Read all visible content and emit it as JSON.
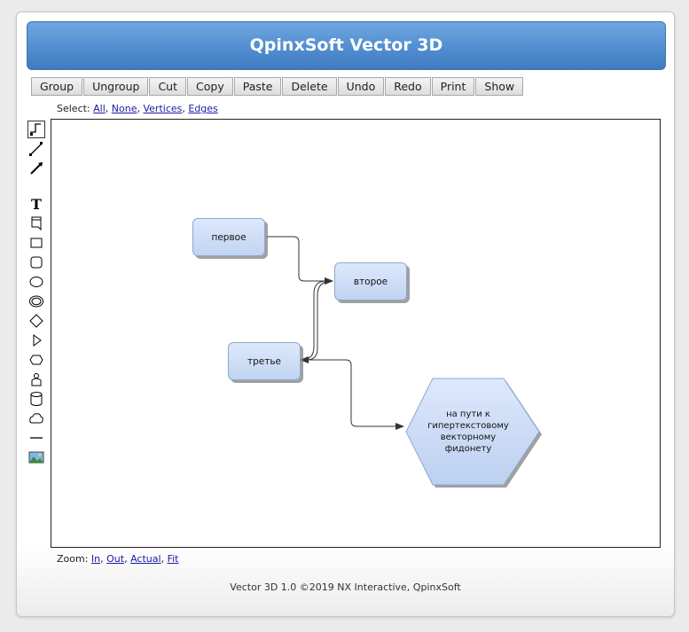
{
  "app": {
    "title": "QpinxSoft Vector 3D"
  },
  "toolbar": {
    "buttons": [
      "Group",
      "Ungroup",
      "Cut",
      "Copy",
      "Paste",
      "Delete",
      "Undo",
      "Redo",
      "Print",
      "Show"
    ]
  },
  "select": {
    "label": "Select:",
    "links": [
      "All",
      "None",
      "Vertices",
      "Edges"
    ]
  },
  "tools": [
    {
      "name": "select-tool-icon",
      "selected": true
    },
    {
      "name": "line-tool-icon"
    },
    {
      "name": "arrow-line-tool-icon"
    },
    {
      "name": "text-tool-icon",
      "glyph": "T"
    },
    {
      "name": "note-shape-tool-icon"
    },
    {
      "name": "rectangle-tool-icon"
    },
    {
      "name": "rounded-rectangle-tool-icon"
    },
    {
      "name": "ellipse-tool-icon"
    },
    {
      "name": "double-ellipse-tool-icon"
    },
    {
      "name": "diamond-tool-icon"
    },
    {
      "name": "triangle-tool-icon"
    },
    {
      "name": "hexagon-tool-icon"
    },
    {
      "name": "actor-tool-icon"
    },
    {
      "name": "cylinder-tool-icon"
    },
    {
      "name": "cloud-tool-icon"
    },
    {
      "name": "horizontal-line-tool-icon"
    },
    {
      "name": "image-tool-icon"
    }
  ],
  "diagram": {
    "nodes": [
      {
        "id": "n1",
        "label": "первое"
      },
      {
        "id": "n2",
        "label": "второе"
      },
      {
        "id": "n3",
        "label": "третье"
      },
      {
        "id": "n4",
        "label": "на пути к\nгипертекстовому\nвекторному\nфидонету"
      }
    ],
    "edges": [
      {
        "from": "n1",
        "to": "n2"
      },
      {
        "from": "n3",
        "to": "n2"
      },
      {
        "from": "n2",
        "to": "n3"
      },
      {
        "from": "n3",
        "to": "n4"
      }
    ]
  },
  "zoom": {
    "label": "Zoom:",
    "links": [
      "In",
      "Out",
      "Actual",
      "Fit"
    ]
  },
  "footer": {
    "text": "Vector 3D 1.0 ©2019 NX Interactive, QpinxSoft"
  },
  "colors": {
    "title_bar": "#4f8bce",
    "node_fill": "#c9daf5",
    "link": "#1a1aa6"
  }
}
